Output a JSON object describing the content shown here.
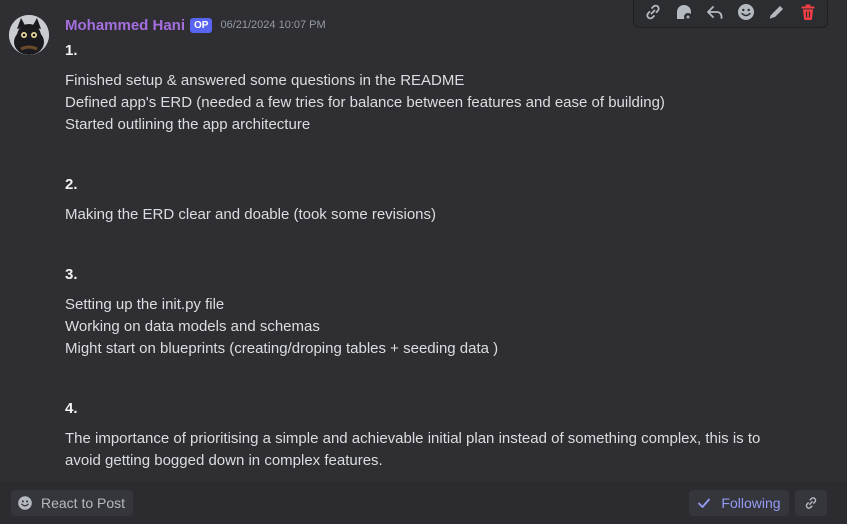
{
  "message": {
    "author": "Mohammed Hani",
    "badge": "OP",
    "timestamp": "06/21/2024 10:07 PM",
    "sections": [
      {
        "heading": "1.",
        "lines": [
          "Finished setup & answered some questions in the  README",
          "Defined app's ERD (needed a few tries for balance between features and ease of building)",
          "Started outlining the app architecture"
        ]
      },
      {
        "heading": "2.",
        "lines": [
          "Making the ERD clear and doable (took some revisions)"
        ]
      },
      {
        "heading": "3.",
        "lines": [
          "Setting up the init.py file",
          "Working on data models and schemas",
          "Might start on blueprints (creating/droping tables  + seeding data )"
        ]
      },
      {
        "heading": "4.",
        "lines": [
          "The importance of prioritising a simple and achievable initial plan instead of something complex, this is to",
          "avoid getting bogged down in complex features."
        ]
      }
    ]
  },
  "toolbar": {
    "icons": [
      "link-icon",
      "thread-icon",
      "reply-icon",
      "add-reaction-icon",
      "edit-icon",
      "delete-icon"
    ],
    "delete_color": "#f23f43"
  },
  "footer": {
    "react_label": "React to Post",
    "following_label": "Following"
  },
  "colors": {
    "username": "#a56fe0",
    "badge": "#5865f2",
    "following": "#949cf7"
  }
}
